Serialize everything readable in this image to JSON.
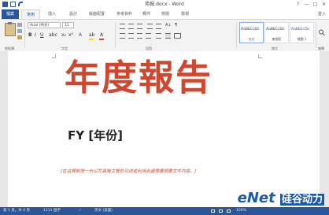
{
  "titlebar": {
    "title": "简报.docx - Word",
    "controls": [
      "?",
      "—",
      "□",
      "✕"
    ]
  },
  "ribbon_tabs": {
    "file": "檔案",
    "items": [
      "常用",
      "插入",
      "設計",
      "版面配置",
      "參考資料",
      "郵件",
      "校閱",
      "檢視"
    ],
    "active_index": 0,
    "user": "登入"
  },
  "ribbon": {
    "clipboard_label": "剪貼簿",
    "font_name": "Arial (內文)",
    "font_size": "11",
    "font_label": "字型",
    "paragraph_label": "段落",
    "styles": [
      {
        "sample": "AaBbCcDc",
        "name": "內文"
      },
      {
        "sample": "AaBbCcDc",
        "name": "無間距"
      },
      {
        "sample": "AaBbCcDc",
        "name": "標題 1"
      }
    ],
    "styles_label": "樣式",
    "editing_label": "編輯",
    "accent_color": "#2b579a"
  },
  "document": {
    "title": "年度報告",
    "year": "FY [年份]",
    "abstract": "[在這裡新增一份公司高階主管的引述或利用此處簡要摘要文件內容。]",
    "title_color": "#d0472f",
    "abstract_color": "#d0472f"
  },
  "statusbar": {
    "page": "第 1 頁，共 4 頁",
    "words": "1111 個字",
    "language": "英文 (美國)",
    "zoom": "100%"
  },
  "watermark": {
    "text": "eNet",
    "cn": "硅谷动力"
  }
}
